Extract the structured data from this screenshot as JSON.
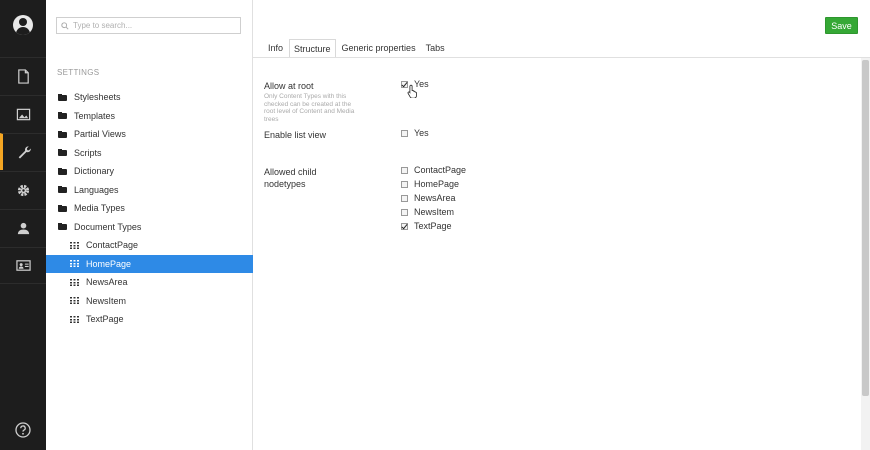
{
  "tree": {
    "search_placeholder": "Type to search...",
    "section_title": "SETTINGS",
    "folders": [
      {
        "label": "Stylesheets"
      },
      {
        "label": "Templates"
      },
      {
        "label": "Partial Views"
      },
      {
        "label": "Scripts"
      },
      {
        "label": "Dictionary"
      },
      {
        "label": "Languages"
      },
      {
        "label": "Media Types"
      },
      {
        "label": "Document Types"
      }
    ],
    "document_types": [
      {
        "label": "ContactPage"
      },
      {
        "label": "HomePage"
      },
      {
        "label": "NewsArea"
      },
      {
        "label": "NewsItem"
      },
      {
        "label": "TextPage"
      }
    ]
  },
  "toolbar": {
    "save_label": "Save"
  },
  "tabs": [
    {
      "label": "Info"
    },
    {
      "label": "Structure"
    },
    {
      "label": "Generic properties"
    },
    {
      "label": "Tabs"
    }
  ],
  "structure": {
    "allow_at_root": {
      "label": "Allow at root",
      "description": "Only Content Types with this checked can be created at the root level of Content and Media trees",
      "option": "Yes",
      "checked": true
    },
    "enable_list_view": {
      "label": "Enable list view",
      "option": "Yes",
      "checked": false
    },
    "allowed_child_nodetypes": {
      "label": "Allowed child nodetypes",
      "options": [
        {
          "label": "ContactPage",
          "checked": false
        },
        {
          "label": "HomePage",
          "checked": false
        },
        {
          "label": "NewsArea",
          "checked": false
        },
        {
          "label": "NewsItem",
          "checked": false
        },
        {
          "label": "TextPage",
          "checked": true
        }
      ]
    }
  },
  "colors": {
    "accent": "#2e8ae6",
    "save": "#35a835",
    "sidebar": "#1d1d1d",
    "active_marker": "#f5a623"
  }
}
